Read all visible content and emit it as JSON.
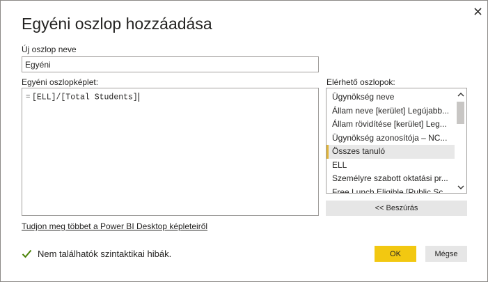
{
  "dialog": {
    "title": "Egyéni oszlop hozzáadása",
    "close_icon": "close-icon"
  },
  "new_column": {
    "label": "Új oszlop neve",
    "value": "Egyéni"
  },
  "formula": {
    "label": "Egyéni oszlopképlet:",
    "prefix": "=",
    "value": "[ELL]/[Total Students]"
  },
  "available_columns": {
    "label": "Elérhető oszlopok:",
    "items": [
      {
        "label": "Ügynökség neve"
      },
      {
        "label": "Állam neve [kerület] Legújabb..."
      },
      {
        "label": "Állam rövidítése [kerület] Leg..."
      },
      {
        "label": "Ügynökség azonosítója – NC..."
      },
      {
        "label": "Összes tanuló",
        "selected": true
      },
      {
        "label": "ELL"
      },
      {
        "label": "Személyre szabott oktatási pr..."
      },
      {
        "label": "Free Lunch Eligible [Public Sc..."
      }
    ],
    "selected_accent": "#e0b43a"
  },
  "insert_button": "<< Beszúrás",
  "learn_more_link": "Tudjon meg többet a Power BI Desktop képleteiről",
  "status": {
    "text": "Nem találhatók szintaktikai hibák.",
    "icon": "checkmark-icon",
    "color": "#498205"
  },
  "buttons": {
    "ok": "OK",
    "cancel": "Mégse",
    "ok_color": "#f2c811"
  }
}
